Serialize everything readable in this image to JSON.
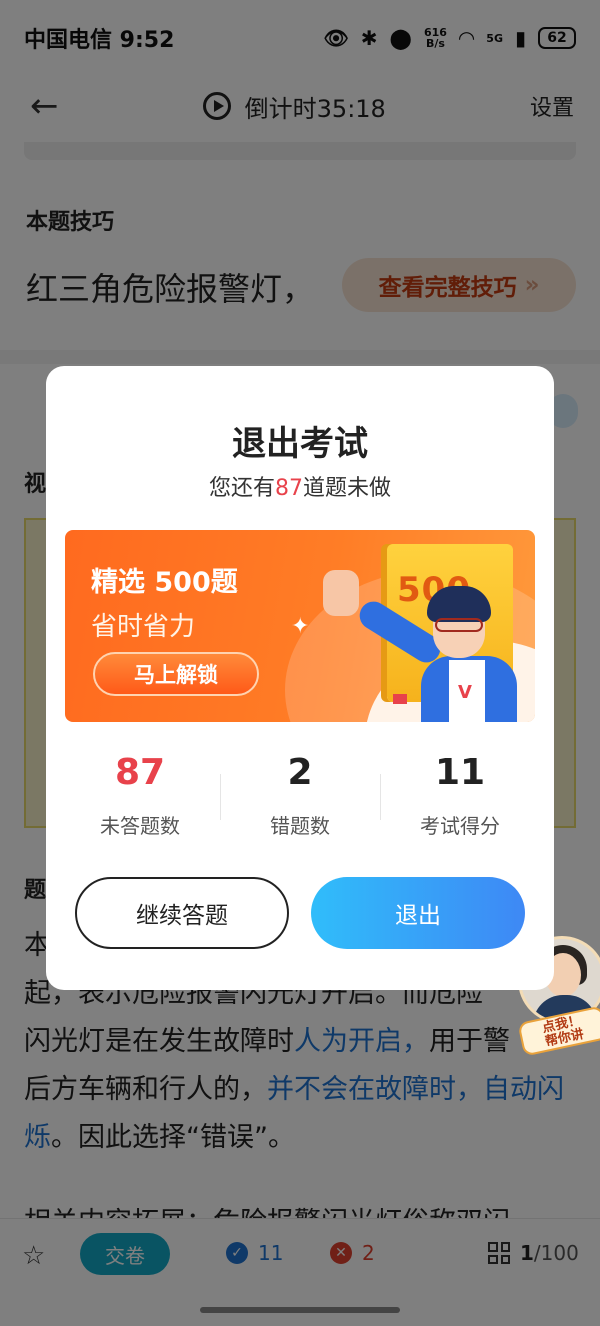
{
  "status_bar": {
    "carrier_time": "中国电信 9:52",
    "net_speed_top": "616",
    "net_speed_bottom": "B/s",
    "signal_label": "5G",
    "battery": "62"
  },
  "nav": {
    "timer": "倒计时35:18",
    "settings": "设置"
  },
  "tip": {
    "title": "本题技巧",
    "text": "红三角危险报警灯，",
    "button": "查看完整技巧",
    "button_chevron": "»"
  },
  "video": {
    "label": "视"
  },
  "answer": {
    "label": "题",
    "text_start": "本",
    "text_part1": "起，表示危险报警闪光灯开启。而危险",
    "text_part2": "闪光灯是在发生故障时",
    "text_blue1": "人为开启，",
    "text_part3": "用于警",
    "text_part4": "后方车辆和行人的，",
    "text_blue2": "并不会在故障时，自动闪烁",
    "text_part5": "。因此选择“错误”。",
    "text_line2": "相关内容拓展：危险报警闪光灯俗称双闪"
  },
  "bottom_bar": {
    "submit": "交卷",
    "correct_count": "11",
    "wrong_count": "2",
    "current_page": "1",
    "total_pages": "/100"
  },
  "helper": {
    "tag_line1": "点我！",
    "tag_line2": "帮你讲"
  },
  "modal": {
    "title": "退出考试",
    "sub_prefix": "您还有",
    "sub_count": "87",
    "sub_suffix": "道题未做",
    "banner": {
      "title": "精选 500题",
      "subtitle": "省时省力",
      "button": "马上解锁",
      "book_number": "500",
      "shirt_letter": "V"
    },
    "stats": [
      {
        "value": "87",
        "label": "未答题数"
      },
      {
        "value": "2",
        "label": "错题数"
      },
      {
        "value": "11",
        "label": "考试得分"
      }
    ],
    "continue_button": "继续答题",
    "exit_button": "退出"
  },
  "colors": {
    "accent_red": "#e8424b",
    "accent_blue": "#3e88f5",
    "banner_orange": "#ff7d26"
  }
}
